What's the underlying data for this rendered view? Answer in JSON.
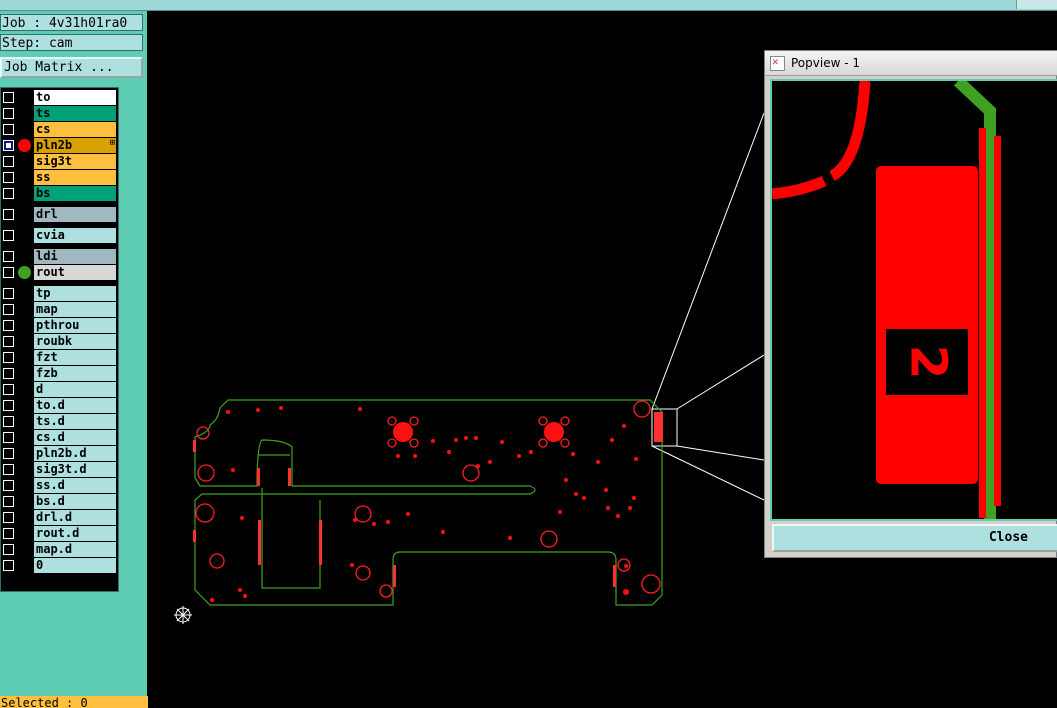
{
  "job": {
    "label": "Job : 4v31h01ra0",
    "step": "Step: cam"
  },
  "matrix_button": "Job Matrix ...",
  "layers": [
    {
      "name": "to",
      "color": "#ffffff",
      "dot": "",
      "group": 0
    },
    {
      "name": "ts",
      "color": "#00a078",
      "dot": "",
      "group": 0
    },
    {
      "name": "cs",
      "color": "#ffc040",
      "dot": "",
      "group": 0
    },
    {
      "name": "pln2b",
      "color": "#d8a000",
      "dot": "#ff0000",
      "group": 0,
      "selected": true,
      "mark": "⊞"
    },
    {
      "name": "sig3t",
      "color": "#ffc040",
      "dot": "",
      "group": 0
    },
    {
      "name": "ss",
      "color": "#ffc040",
      "dot": "",
      "group": 0
    },
    {
      "name": "bs",
      "color": "#00a078",
      "dot": "",
      "group": 0
    },
    {
      "name": "drl",
      "color": "#a0b8c0",
      "dot": "",
      "group": 1
    },
    {
      "name": "cvia",
      "color": "#aee0e0",
      "dot": "",
      "group": 2
    },
    {
      "name": "ldi",
      "color": "#a0b8c0",
      "dot": "",
      "group": 3
    },
    {
      "name": "rout",
      "color": "#d8d8d8",
      "dot": "#40a020",
      "group": 3
    },
    {
      "name": "tp",
      "color": "#aee0e0",
      "dot": "",
      "group": 4
    },
    {
      "name": "map",
      "color": "#aee0e0",
      "dot": "",
      "group": 4
    },
    {
      "name": "pthrou",
      "color": "#aee0e0",
      "dot": "",
      "group": 4
    },
    {
      "name": "roubk",
      "color": "#aee0e0",
      "dot": "",
      "group": 4
    },
    {
      "name": "fzt",
      "color": "#aee0e0",
      "dot": "",
      "group": 4
    },
    {
      "name": "fzb",
      "color": "#aee0e0",
      "dot": "",
      "group": 4
    },
    {
      "name": "d",
      "color": "#aee0e0",
      "dot": "",
      "group": 4
    },
    {
      "name": "to.d",
      "color": "#aee0e0",
      "dot": "",
      "group": 4
    },
    {
      "name": "ts.d",
      "color": "#aee0e0",
      "dot": "",
      "group": 4
    },
    {
      "name": "cs.d",
      "color": "#aee0e0",
      "dot": "",
      "group": 4
    },
    {
      "name": "pln2b.d",
      "color": "#aee0e0",
      "dot": "",
      "group": 4
    },
    {
      "name": "sig3t.d",
      "color": "#aee0e0",
      "dot": "",
      "group": 4
    },
    {
      "name": "ss.d",
      "color": "#aee0e0",
      "dot": "",
      "group": 4
    },
    {
      "name": "bs.d",
      "color": "#aee0e0",
      "dot": "",
      "group": 4
    },
    {
      "name": "drl.d",
      "color": "#aee0e0",
      "dot": "",
      "group": 4
    },
    {
      "name": "rout.d",
      "color": "#aee0e0",
      "dot": "",
      "group": 4
    },
    {
      "name": "map.d",
      "color": "#aee0e0",
      "dot": "",
      "group": 4
    },
    {
      "name": "0",
      "color": "#aee0e0",
      "dot": "",
      "group": 4
    }
  ],
  "status": {
    "selected": "Selected : 0"
  },
  "popview": {
    "title": "Popview - 1",
    "close_label": "Close",
    "pad_label": "2"
  },
  "colors": {
    "panel": "#5fcdb4",
    "field": "#aee0e0",
    "copper": "#ff0000",
    "outline": "#40a020"
  }
}
